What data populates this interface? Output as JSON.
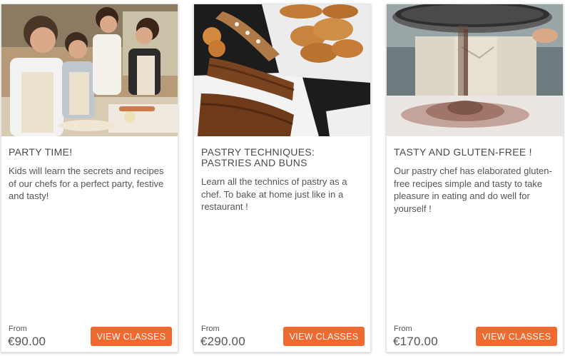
{
  "cards": [
    {
      "title": "PARTY TIME!",
      "description": "Kids will learn the secrets and recipes of our chefs for a perfect party, festive and tasty!",
      "from_label": "From",
      "price": "€90.00",
      "button_label": "VIEW CLASSES"
    },
    {
      "title": "PASTRY TECHNIQUES: PASTRIES AND BUNS",
      "description": "Learn all the technics of pastry as a chef. To bake at home just like in a restaurant !",
      "from_label": "From",
      "price": "€290.00",
      "button_label": "VIEW CLASSES"
    },
    {
      "title": "TASTY AND GLUTEN-FREE !",
      "description": "Our pastry chef has elaborated gluten-free recipes simple and tasty to take pleasure in eating and do well for yourself !",
      "from_label": "From",
      "price": "€170.00",
      "button_label": "VIEW CLASSES"
    }
  ],
  "colors": {
    "accent": "#f06a2f",
    "text": "#4a4a4a"
  }
}
